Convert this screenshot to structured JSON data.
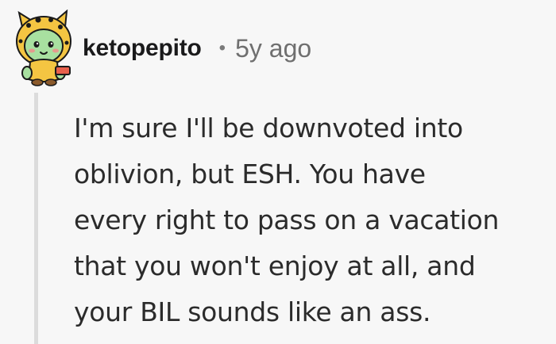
{
  "comment": {
    "author": "ketopepito",
    "separator": "•",
    "age": "5y ago",
    "avatar_icon": "snoo-avatar-yellow-hood-icon",
    "body_lines": [
      "I'm sure I'll be downvoted into",
      "oblivion, but ESH. You have",
      "every right to pass on a vacation",
      "that you won't enjoy at all, and",
      "your BIL sounds like an ass."
    ]
  },
  "colors": {
    "background": "#f7f7f7",
    "thread_line": "#dcdcdc",
    "author_text": "#1a1a1b",
    "meta_text": "#6f6f6f",
    "body_text": "#2b2b2b",
    "avatar_hood": "#f4c542",
    "avatar_face": "#a8e0a0"
  }
}
